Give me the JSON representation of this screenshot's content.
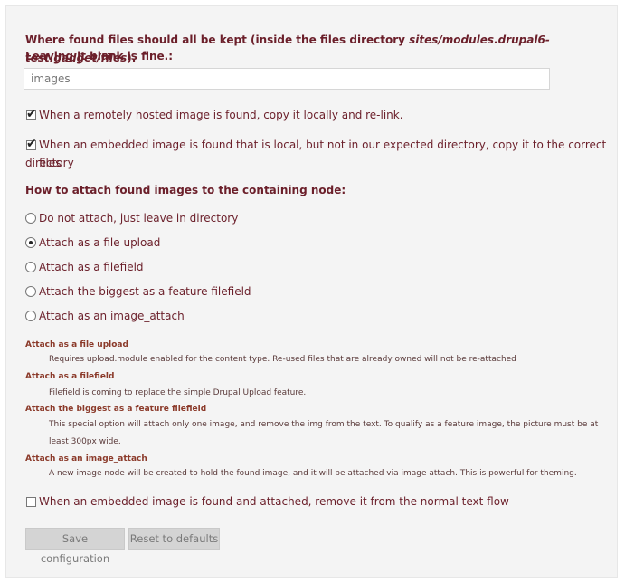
{
  "files_dir": {
    "label_prefix": "Where found files should all be kept (inside the files directory ",
    "label_path": "sites/modules.drupal6-test.gadget/files",
    "label_suffix": ").",
    "label_line2": "Leaving it blank is fine.:",
    "value": "images"
  },
  "checkbox_copy_remote": {
    "checked": true,
    "label": "When a remotely hosted image is found, copy it locally and re-link."
  },
  "checkbox_copy_local": {
    "checked": true,
    "label_line1": "When an embedded image is found that is local, but not in our expected directory, copy it to the correct files",
    "label_line2": "directory"
  },
  "attach_section": {
    "heading": "How to attach found images to the containing node:",
    "options": [
      {
        "label": "Do not attach, just leave in directory",
        "selected": false
      },
      {
        "label": "Attach as a file upload",
        "selected": true
      },
      {
        "label": "Attach as a filefield",
        "selected": false
      },
      {
        "label": "Attach the biggest as a feature filefield",
        "selected": false
      },
      {
        "label": "Attach as an image_attach",
        "selected": false
      }
    ]
  },
  "help": [
    {
      "title": "Attach as a file upload",
      "desc": "Requires upload.module enabled for the content type. Re-used files that are already owned will not be re-attached"
    },
    {
      "title": "Attach as a filefield",
      "desc": "Filefield is coming to replace the simple Drupal Upload feature."
    },
    {
      "title": "Attach the biggest as a feature filefield",
      "desc1": "This special option will attach only one image, and remove the img from the text. To qualify as a feature image, the picture must be at",
      "desc2": "least 300px wide."
    },
    {
      "title": "Attach as an image_attach",
      "desc": "A new image node will be created to hold the found image, and it will be attached via image attach. This is powerful for theming."
    }
  ],
  "checkbox_remove_flow": {
    "checked": false,
    "label": "When an embedded image is found and attached, remove it from the normal text flow"
  },
  "buttons": {
    "save": "Save configuration",
    "reset": "Reset to defaults"
  }
}
